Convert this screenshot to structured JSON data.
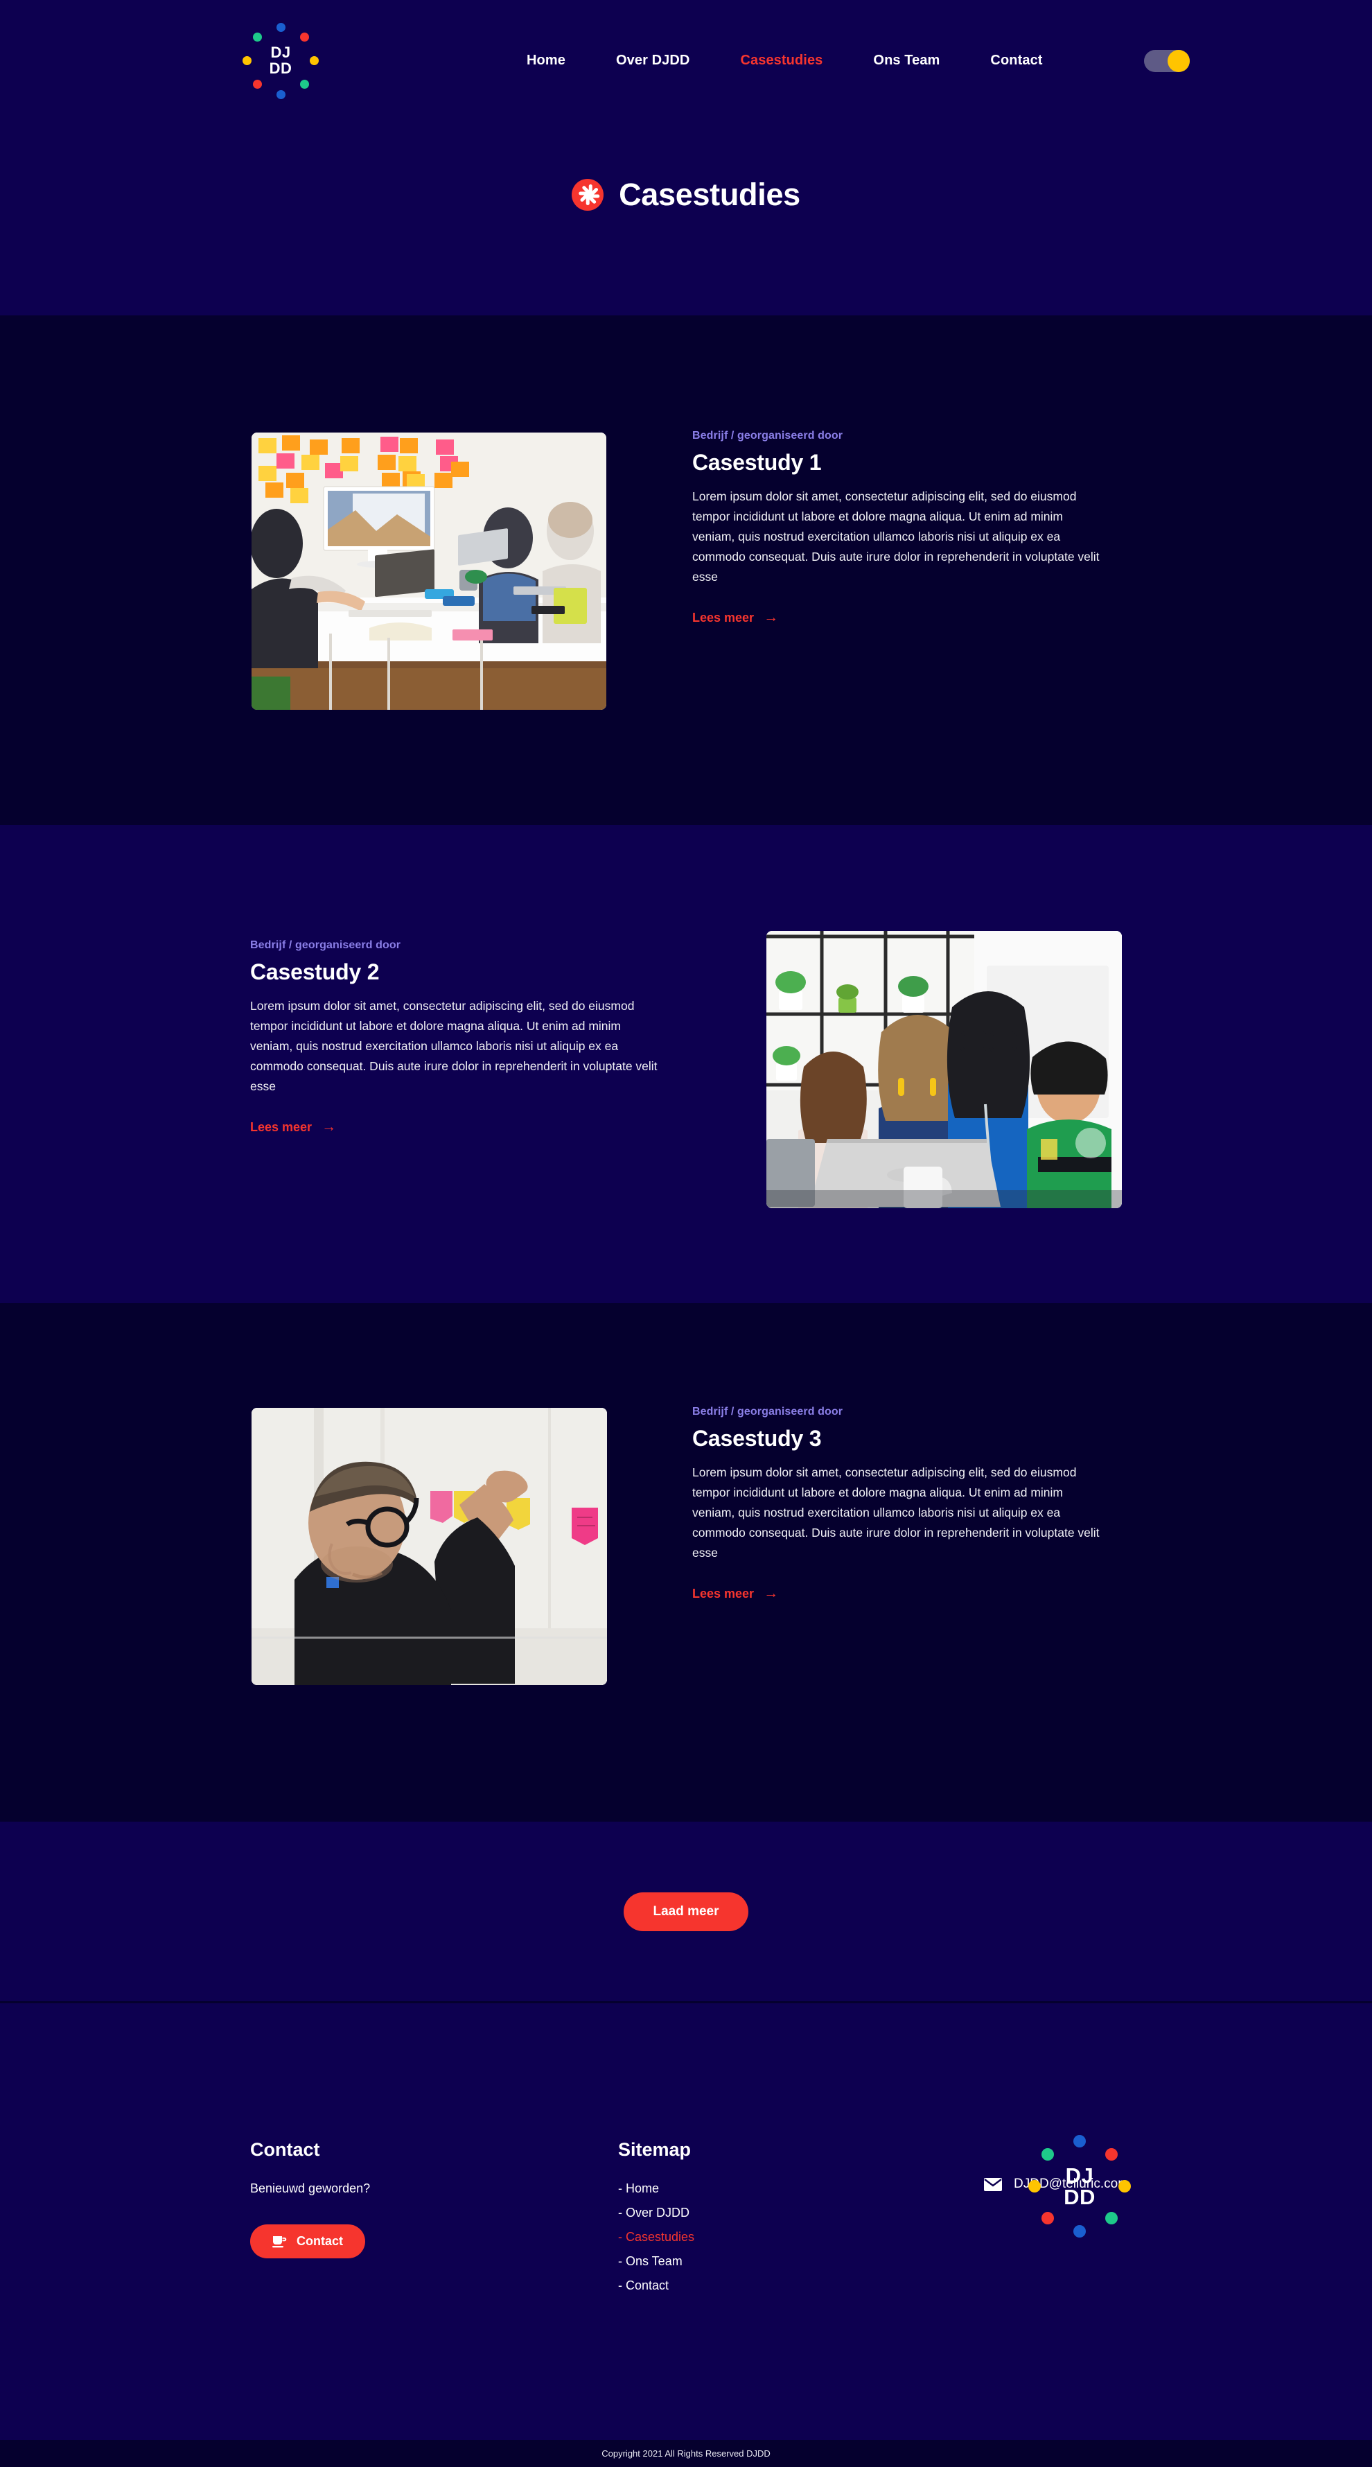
{
  "theme": {
    "bg_nav": "#0d0050",
    "bg_dark": "#05002e",
    "bg_light": "#0d0050",
    "accent_red": "#f6352e",
    "eyebrow_purple": "#8b7fe8",
    "toggle_track": "#5e5a86",
    "toggle_knob": "#ffc400",
    "dot_blue": "#1a5fd0",
    "dot_red": "#f6352e",
    "dot_green": "#1ec98a",
    "dot_yellow": "#ffc400"
  },
  "nav": {
    "logo": {
      "line1": "DJ",
      "line2": "DD"
    },
    "links": [
      {
        "label": "Home",
        "active": false
      },
      {
        "label": "Over DJDD",
        "active": false
      },
      {
        "label": "Casestudies",
        "active": true
      },
      {
        "label": "Ons Team",
        "active": false
      },
      {
        "label": "Contact",
        "active": false
      }
    ],
    "toggle": {
      "state": "on"
    }
  },
  "hero": {
    "title": "Casestudies",
    "icon": "asterisk-burst-icon"
  },
  "cases": [
    {
      "eyebrow": "Bedrijf  / georganiseerd door",
      "title": "Casestudy 1",
      "body": "Lorem ipsum dolor sit amet, consectetur adipiscing elit, sed do eiusmod tempor incididunt ut labore et dolore magna aliqua. Ut enim ad minim veniam, quis nostrud exercitation ullamco laboris nisi ut aliquip ex ea commodo consequat. Duis aute irure dolor in reprehenderit in voluptate velit esse",
      "link_label": "Lees meer",
      "image_alt": "Team meeting around a white table with sticky notes on the wall and a monitor",
      "layout": "image-left"
    },
    {
      "eyebrow": "Bedrijf / georganiseerd door",
      "title": "Casestudy 2",
      "body": "Lorem ipsum dolor sit amet, consectetur adipiscing elit, sed do eiusmod tempor incididunt ut labore et dolore magna aliqua. Ut enim ad minim veniam, quis nostrud exercitation ullamco laboris nisi ut aliquip ex ea commodo consequat. Duis aute irure dolor in reprehenderit in voluptate velit esse",
      "link_label": "Lees meer",
      "image_alt": "Four colleagues smiling at a laptop with plant shelves behind them",
      "layout": "image-right"
    },
    {
      "eyebrow": "Bedrijf / georganiseerd door",
      "title": "Casestudy 3",
      "body": "Lorem ipsum dolor sit amet, consectetur adipiscing elit, sed do eiusmod tempor incididunt ut labore et dolore magna aliqua. Ut enim ad minim veniam, quis nostrud exercitation ullamco laboris nisi ut aliquip ex ea commodo consequat. Duis aute irure dolor in reprehenderit in voluptate velit esse",
      "link_label": "Lees meer",
      "image_alt": "Man with glasses placing sticky notes on a whiteboard",
      "layout": "image-left"
    }
  ],
  "load_more": {
    "label": "Laad meer"
  },
  "footer": {
    "contact": {
      "heading": "Contact",
      "subtitle": "Benieuwd geworden?",
      "button_label": "Contact",
      "button_icon": "coffee-cup-icon"
    },
    "sitemap": {
      "heading": "Sitemap",
      "items": [
        {
          "label": "- Home",
          "active": false
        },
        {
          "label": "- Over DJDD",
          "active": false
        },
        {
          "label": "- Casestudies",
          "active": true
        },
        {
          "label": "- Ons Team",
          "active": false
        },
        {
          "label": "- Contact",
          "active": false
        }
      ]
    },
    "brand": {
      "logo": {
        "line1": "DJ",
        "line2": "DD"
      },
      "email": "DJDD@telluric.com",
      "email_icon": "envelope-icon"
    }
  },
  "copyright": {
    "text": "Copyright 2021 All Rights Reserved DJDD"
  }
}
